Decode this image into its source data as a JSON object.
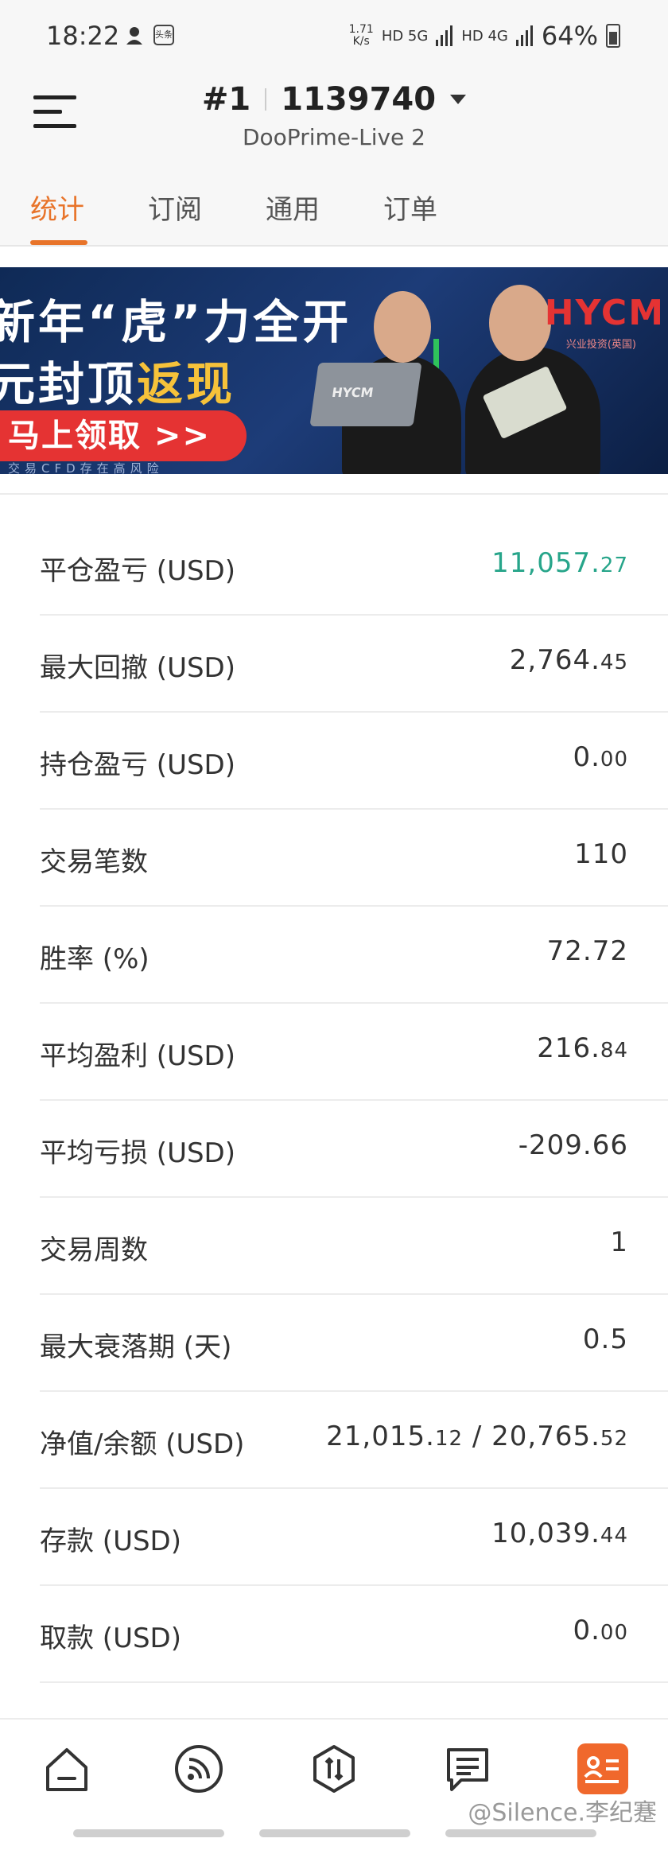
{
  "status_bar": {
    "time": "18:22",
    "speed_value": "1.71",
    "speed_unit": "K/s",
    "net1": "HD 5G",
    "net2": "HD 4G",
    "battery": "64%",
    "app_badge": "头条"
  },
  "header": {
    "account_index": "#1",
    "account_number": "1139740",
    "server": "DooPrime-Live 2"
  },
  "tabs": [
    {
      "label": "统计",
      "active": true
    },
    {
      "label": "订阅",
      "active": false
    },
    {
      "label": "通用",
      "active": false
    },
    {
      "label": "订单",
      "active": false
    }
  ],
  "banner": {
    "line1": "新年“虎”力全开",
    "line2_prefix": "元封顶",
    "line2_highlight": "返现",
    "cta": "马上领取 >>",
    "disclaimer": "交易CFD存在高风险",
    "brand": "HYCM",
    "brand_sub": "兴业投资(英国)",
    "laptop_label": "HYCM"
  },
  "stats": [
    {
      "label": "平仓盈亏 (USD)",
      "int": "11,057.",
      "dec": "27",
      "positive": true
    },
    {
      "label": "最大回撤 (USD)",
      "int": "2,764.",
      "dec": "45"
    },
    {
      "label": "持仓盈亏 (USD)",
      "int": "0.",
      "dec": "00"
    },
    {
      "label": "交易笔数",
      "int": "110",
      "dec": ""
    },
    {
      "label": "胜率 (%)",
      "int": "72.72",
      "dec": ""
    },
    {
      "label": "平均盈利 (USD)",
      "int": "216.",
      "dec": "84"
    },
    {
      "label": "平均亏损 (USD)",
      "int": "-209.66",
      "dec": ""
    },
    {
      "label": "交易周数",
      "int": "1",
      "dec": ""
    },
    {
      "label": "最大衰落期 (天)",
      "int": "0.5",
      "dec": ""
    },
    {
      "label": "净值/余额 (USD)",
      "int": "21,015.",
      "dec": "12",
      "int2": " / 20,765.",
      "dec2": "52"
    },
    {
      "label": "存款 (USD)",
      "int": "10,039.",
      "dec": "44"
    },
    {
      "label": "取款 (USD)",
      "int": "0.",
      "dec": "00"
    }
  ],
  "bottom_nav": [
    {
      "icon": "home-icon"
    },
    {
      "icon": "signal-feed-icon"
    },
    {
      "icon": "trade-icon"
    },
    {
      "icon": "message-icon"
    },
    {
      "icon": "profile-card-icon",
      "active": true
    }
  ],
  "watermark": "@Silence.李纪蹇",
  "colors": {
    "accent": "#e8742a",
    "positive": "#27a58a",
    "nav_active": "#f0682c"
  }
}
